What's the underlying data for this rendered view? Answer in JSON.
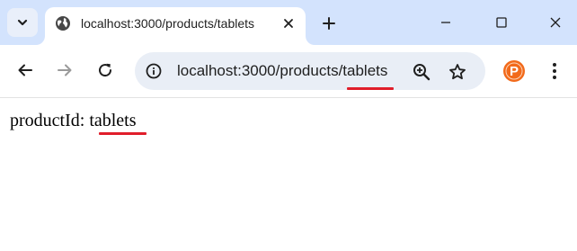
{
  "browser": {
    "tab": {
      "title": "localhost:3000/products/tablets",
      "favicon": "globe-icon"
    },
    "address_bar": {
      "url": "localhost:3000/products/tablets"
    },
    "icons": {
      "tab_search": "chevron-down-icon",
      "tab_close": "close-icon",
      "new_tab": "plus-icon",
      "minimize": "minimize-icon",
      "maximize": "maximize-icon",
      "close_window": "close-icon",
      "back": "arrow-left-icon",
      "forward": "arrow-right-icon",
      "reload": "reload-icon",
      "site_info": "info-icon",
      "zoom": "zoom-in-icon",
      "bookmark": "star-icon",
      "extension": "extension-p-icon",
      "menu": "more-vert-icon"
    },
    "colors": {
      "tabstrip": "#d3e3fd",
      "omnibox": "#e9eef6",
      "highlight": "#e01e2b",
      "extension": "#f26a1b"
    },
    "extension_badge": "P"
  },
  "page": {
    "label": "productId:",
    "value": "tablets"
  }
}
